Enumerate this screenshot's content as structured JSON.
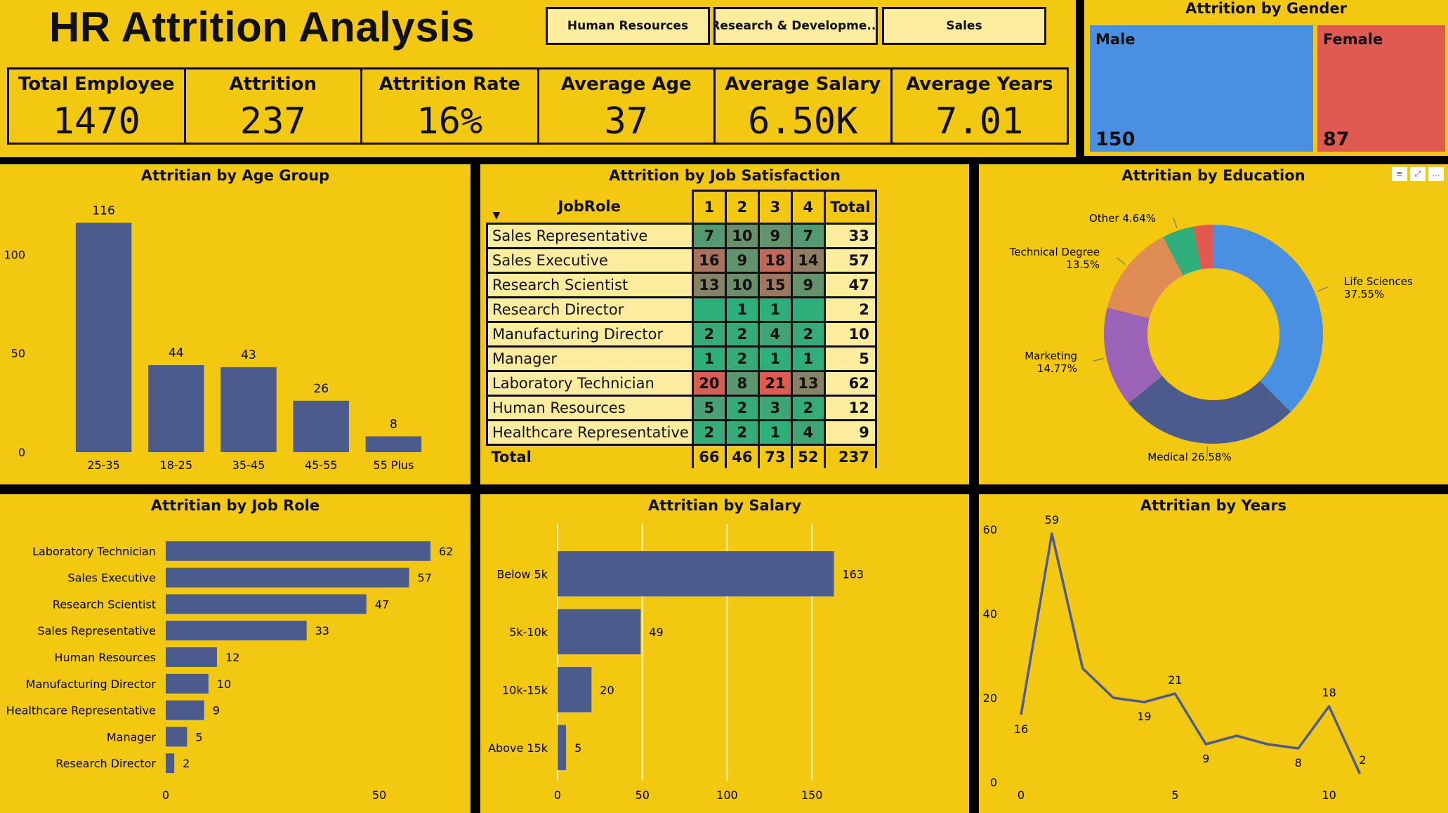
{
  "header": {
    "title": "HR Attrition Analysis",
    "slicers": [
      "Human Resources",
      "Research & Developme...",
      "Sales"
    ]
  },
  "kpis": [
    {
      "label": "Total Employee",
      "value": "1470"
    },
    {
      "label": "Attrition",
      "value": "237"
    },
    {
      "label": "Attrition Rate",
      "value": "16%"
    },
    {
      "label": "Average Age",
      "value": "37"
    },
    {
      "label": "Average Salary",
      "value": "6.50K"
    },
    {
      "label": "Average Years",
      "value": "7.01"
    }
  ],
  "gender": {
    "title": "Attrition by Gender",
    "male_label": "Male",
    "male_value": "150",
    "female_label": "Female",
    "female_value": "87",
    "colors": {
      "male": "#4A90E2",
      "female": "#E05A52"
    }
  },
  "satisfaction": {
    "title": "Attrition by Job Satisfaction",
    "col_header": "JobRole",
    "levels": [
      "1",
      "2",
      "3",
      "4"
    ],
    "total_label": "Total",
    "rows": [
      {
        "role": "Sales Representative",
        "vals": [
          "7",
          "10",
          "9",
          "7"
        ],
        "total": "33"
      },
      {
        "role": "Sales Executive",
        "vals": [
          "16",
          "9",
          "18",
          "14"
        ],
        "total": "57"
      },
      {
        "role": "Research Scientist",
        "vals": [
          "13",
          "10",
          "15",
          "9"
        ],
        "total": "47"
      },
      {
        "role": "Research Director",
        "vals": [
          "",
          "1",
          "1",
          ""
        ],
        "total": "2"
      },
      {
        "role": "Manufacturing Director",
        "vals": [
          "2",
          "2",
          "4",
          "2"
        ],
        "total": "10"
      },
      {
        "role": "Manager",
        "vals": [
          "1",
          "2",
          "1",
          "1"
        ],
        "total": "5"
      },
      {
        "role": "Laboratory Technician",
        "vals": [
          "20",
          "8",
          "21",
          "13"
        ],
        "total": "62"
      },
      {
        "role": "Human Resources",
        "vals": [
          "5",
          "2",
          "3",
          "2"
        ],
        "total": "12"
      },
      {
        "role": "Healthcare Representative",
        "vals": [
          "2",
          "2",
          "1",
          "4"
        ],
        "total": "9"
      }
    ],
    "totals": [
      "66",
      "46",
      "73",
      "52",
      "237"
    ]
  },
  "chart_data": [
    {
      "id": "age",
      "type": "bar",
      "title": "Attritian by Age Group",
      "categories": [
        "25-35",
        "18-25",
        "35-45",
        "45-55",
        "55 Plus"
      ],
      "values": [
        116,
        44,
        43,
        26,
        8
      ],
      "yticks": [
        "0",
        "50",
        "100"
      ],
      "ylim": [
        0,
        120
      ],
      "color": "#4A5B8C"
    },
    {
      "id": "education",
      "type": "pie",
      "title": "Attritian by Education",
      "labels": [
        "Life Sciences",
        "Medical",
        "Marketing",
        "Technical Degree",
        "Other",
        ""
      ],
      "label_text": [
        "Life Sciences 37.55%",
        "Medical 26.58%",
        "Marketing 14.77%",
        "Technical Degree 13.5%",
        "Other 4.64%"
      ],
      "values": [
        37.55,
        26.58,
        14.77,
        13.5,
        4.64,
        2.96
      ],
      "colors": [
        "#4A90E2",
        "#4A5B8C",
        "#9B63B5",
        "#E08C55",
        "#2EAE7A",
        "#E05A52"
      ]
    },
    {
      "id": "role",
      "type": "bar",
      "title": "Attritian by Job Role",
      "categories": [
        "Laboratory Technician",
        "Sales Executive",
        "Research Scientist",
        "Sales Representative",
        "Human Resources",
        "Manufacturing Director",
        "Healthcare Representative",
        "Manager",
        "Research Director"
      ],
      "values": [
        62,
        57,
        47,
        33,
        12,
        10,
        9,
        5,
        2
      ],
      "xticks": [
        "0",
        "50"
      ],
      "color": "#4A5B8C"
    },
    {
      "id": "salary",
      "type": "bar",
      "title": "Attritian by Salary",
      "categories": [
        "Below 5k",
        "5k-10k",
        "10k-15k",
        "Above 15k"
      ],
      "values": [
        163,
        49,
        20,
        5
      ],
      "xticks": [
        "0",
        "50",
        "100",
        "150"
      ],
      "color": "#4A5B8C"
    },
    {
      "id": "years",
      "type": "line",
      "title": "Attritian by Years",
      "x": [
        0,
        1,
        2,
        3,
        4,
        5,
        6,
        7,
        8,
        9,
        10,
        11
      ],
      "values": [
        16,
        59,
        27,
        20,
        19,
        21,
        9,
        11,
        9,
        8,
        18,
        2
      ],
      "point_labels": [
        "16",
        "59",
        "",
        "",
        "19",
        "21",
        "9",
        "",
        "",
        "8",
        "18",
        "2"
      ],
      "xticks": [
        "0",
        "5",
        "10"
      ],
      "yticks": [
        "0",
        "20",
        "40",
        "60"
      ],
      "ylim": [
        0,
        60
      ],
      "color": "#4A5B8C"
    }
  ],
  "colors": {
    "background": "#F2C811",
    "heat_high": "#E05A52",
    "heat_low": "#2EAE7A",
    "heat_mid": "#6E8C6A"
  }
}
